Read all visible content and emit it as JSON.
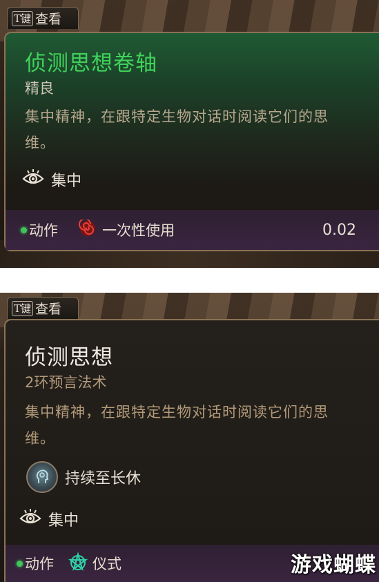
{
  "top_card": {
    "key_tab": {
      "key": "T键",
      "label": "查看"
    },
    "title": "侦测思想卷轴",
    "rarity": "精良",
    "description": "集中精神，在跟特定生物对话时阅读它们的思维。",
    "concentration_label": "集中",
    "footer": {
      "action_label": "动作",
      "usage_label": "一次性使用",
      "weight": "0.02"
    },
    "colors": {
      "title": "#3fd35a",
      "rarity": "#cfc6b6",
      "description": "#b8a88f"
    }
  },
  "bottom_card": {
    "key_tab": {
      "key": "T键",
      "label": "查看"
    },
    "title": "侦测思想",
    "spell_level": "2环预言法术",
    "description": "集中精神，在跟特定生物对话时阅读它们的思维。",
    "duration_label": "持续至长休",
    "concentration_label": "集中",
    "footer": {
      "action_label": "动作",
      "ritual_label": "仪式"
    },
    "colors": {
      "title": "#f2ede4",
      "spell_level": "#b39b7a",
      "description": "#b39b7a"
    }
  },
  "watermark": "游戏蝴蝶",
  "icons": [
    "eye-icon",
    "spiral-icon",
    "weight-icon",
    "duration-mind-icon",
    "ritual-pentagram-icon",
    "action-dot-icon"
  ]
}
